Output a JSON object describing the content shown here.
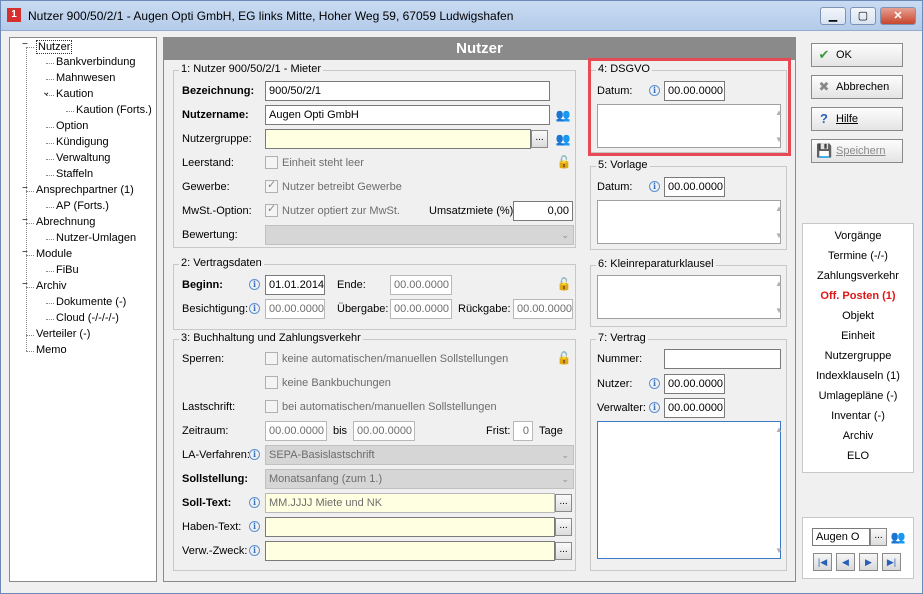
{
  "window": {
    "title": "Nutzer 900/50/2/1 - Augen Opti GmbH, EG links Mitte, Hoher Weg 59, 67059 Ludwigshafen",
    "icon_text": "1",
    "min": "▁",
    "max": "▢",
    "close": "✕"
  },
  "tree": {
    "items": [
      {
        "label": "Nutzer",
        "indent": 0,
        "expander": "−"
      },
      {
        "label": "Bankverbindung",
        "indent": 1
      },
      {
        "label": "Mahnwesen",
        "indent": 1
      },
      {
        "label": "Kaution",
        "indent": 1,
        "expander": "⌄"
      },
      {
        "label": "Kaution (Forts.)",
        "indent": 2
      },
      {
        "label": "Option",
        "indent": 1
      },
      {
        "label": "Kündigung",
        "indent": 1
      },
      {
        "label": "Verwaltung",
        "indent": 1
      },
      {
        "label": "Staffeln",
        "indent": 1
      },
      {
        "label": "Ansprechpartner (1)",
        "indent": 0,
        "expander": "−"
      },
      {
        "label": "AP (Forts.)",
        "indent": 1
      },
      {
        "label": "Abrechnung",
        "indent": 0,
        "expander": "−"
      },
      {
        "label": "Nutzer-Umlagen",
        "indent": 1
      },
      {
        "label": "Module",
        "indent": 0,
        "expander": "−"
      },
      {
        "label": "FiBu",
        "indent": 1
      },
      {
        "label": "Archiv",
        "indent": 0,
        "expander": "−"
      },
      {
        "label": "Dokumente (-)",
        "indent": 1
      },
      {
        "label": "Cloud (-/-/-/-)",
        "indent": 1
      },
      {
        "label": "Verteiler (-)",
        "indent": 0
      },
      {
        "label": "Memo",
        "indent": 0
      }
    ]
  },
  "main": {
    "header": "Nutzer",
    "g1": {
      "title": "1: Nutzer 900/50/2/1 - Mieter",
      "bezeichnung_label": "Bezeichnung:",
      "bezeichnung": "900/50/2/1",
      "nutzername_label": "Nutzername:",
      "nutzername": "Augen Opti GmbH",
      "nutzergruppe_label": "Nutzergruppe:",
      "nutzergruppe": "",
      "leerstand_label": "Leerstand:",
      "leerstand_chk": "Einheit steht leer",
      "gewerbe_label": "Gewerbe:",
      "gewerbe_chk": "Nutzer betreibt Gewerbe",
      "mwst_label": "MwSt.-Option:",
      "mwst_chk": "Nutzer optiert zur MwSt.",
      "umsatz_label": "Umsatzmiete (%):",
      "umsatz": "0,00",
      "bewertung_label": "Bewertung:",
      "bewertung": ""
    },
    "g2": {
      "title": "2: Vertragsdaten",
      "beginn_label": "Beginn:",
      "beginn": "01.01.2014",
      "ende_label": "Ende:",
      "ende": "00.00.0000",
      "besichtigung_label": "Besichtigung:",
      "besichtigung": "00.00.0000",
      "uebergabe_label": "Übergabe:",
      "uebergabe": "00.00.0000",
      "rueckgabe_label": "Rückgabe:",
      "rueckgabe": "00.00.0000"
    },
    "g3": {
      "title": "3: Buchhaltung und Zahlungsverkehr",
      "sperren_label": "Sperren:",
      "sperren_chk1": "keine automatischen/manuellen Sollstellungen",
      "sperren_chk2": "keine Bankbuchungen",
      "lastschrift_label": "Lastschrift:",
      "lastschrift_chk": "bei automatischen/manuellen Sollstellungen",
      "zeitraum_label": "Zeitraum:",
      "zeitraum_von": "00.00.0000",
      "bis": "bis",
      "zeitraum_bis": "00.00.0000",
      "frist_label": "Frist:",
      "frist": "0",
      "tage": "Tage",
      "la_label": "LA-Verfahren:",
      "la": "SEPA-Basislastschrift",
      "soll_label": "Sollstellung:",
      "soll": "Monatsanfang (zum 1.)",
      "solltext_label": "Soll-Text:",
      "solltext": "MM.JJJJ Miete und NK",
      "habentext_label": "Haben-Text:",
      "habentext": "",
      "verw_label": "Verw.-Zweck:",
      "verw": ""
    },
    "g4": {
      "title": "4: DSGVO",
      "datum_label": "Datum:",
      "datum": "00.00.0000"
    },
    "g5": {
      "title": "5: Vorlage",
      "datum_label": "Datum:",
      "datum": "00.00.0000"
    },
    "g6": {
      "title": "6: Kleinreparaturklausel"
    },
    "g7": {
      "title": "7: Vertrag",
      "nummer_label": "Nummer:",
      "nummer": "",
      "nutzer_label": "Nutzer:",
      "nutzer": "00.00.0000",
      "verwalter_label": "Verwalter:",
      "verwalter": "00.00.0000"
    }
  },
  "actions": {
    "ok": "OK",
    "abbrechen": "Abbrechen",
    "hilfe": "Hilfe",
    "speichern": "Speichern"
  },
  "links": [
    "Vorgänge",
    "Termine (-/-)",
    "Zahlungsverkehr",
    "Off. Posten (1)",
    "Objekt",
    "Einheit",
    "Nutzergruppe",
    "Indexklauseln (1)",
    "Umlagepläne (-)",
    "Inventar (-)",
    "Archiv",
    "ELO"
  ],
  "nav": {
    "search": "Augen O",
    "first": "|◀",
    "prev": "◀",
    "next": "▶",
    "last": "▶|"
  },
  "colors": {
    "highlight": "#e84a55",
    "red_link": "#e01515"
  }
}
